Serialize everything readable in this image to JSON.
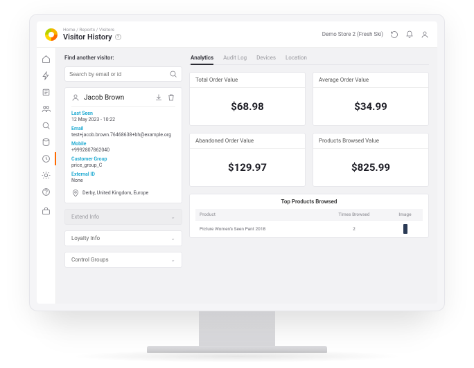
{
  "header": {
    "breadcrumb": "Home / Reports / Visitors",
    "title": "Visitor History",
    "store": "Demo Store 2 (Fresh Ski)"
  },
  "left": {
    "find_label": "Find another visitor:",
    "search_placeholder": "Search by email or id",
    "visitor_name": "Jacob Brown",
    "last_seen_label": "Last Seen",
    "last_seen_value": "12 May 2023 - 10:22",
    "email_label": "Email",
    "email_value": "test+jacob.brown.76468638+bh@example.org",
    "mobile_label": "Mobile",
    "mobile_value": "+9992807862040",
    "group_label": "Customer Group",
    "group_value": "price_group_C",
    "ext_label": "External ID",
    "ext_value": "None",
    "location": "Derby, United Kingdom, Europe",
    "acc_extend": "Extend Info",
    "acc_loyalty": "Loyalty Info",
    "acc_control": "Control Groups"
  },
  "tabs": [
    "Analytics",
    "Audit Log",
    "Devices",
    "Location"
  ],
  "kpis": [
    {
      "label": "Total Order Value",
      "value": "$68.98"
    },
    {
      "label": "Average Order Value",
      "value": "$34.99"
    },
    {
      "label": "Abandoned Order Value",
      "value": "$129.97"
    },
    {
      "label": "Products Browsed Value",
      "value": "$825.99"
    }
  ],
  "top_products": {
    "title": "Top Products Browsed",
    "columns": [
      "Product",
      "Times Browsed",
      "Image"
    ],
    "row": {
      "product": "Picture Women's Seen Pant 2018",
      "times": "2"
    }
  }
}
